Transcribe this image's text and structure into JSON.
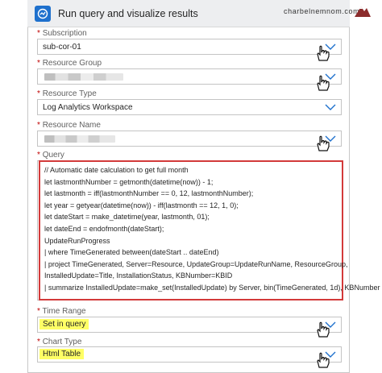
{
  "header": {
    "title": "Run query and visualize results",
    "icon": "azure-monitor-logs-icon",
    "accent": "#1e70cd"
  },
  "watermark": "charbelnemnom.com",
  "fields": {
    "subscription": {
      "label": "Subscription",
      "value": "sub-cor-01"
    },
    "resource_group": {
      "label": "Resource Group",
      "value": ""
    },
    "resource_type": {
      "label": "Resource Type",
      "value": "Log Analytics Workspace"
    },
    "resource_name": {
      "label": "Resource Name",
      "value": ""
    },
    "query": {
      "label": "Query",
      "lines": [
        "// Automatic date calculation to get full month",
        "let lastmonthNumber = getmonth(datetime(now)) - 1;",
        "let lastmonth = iff(lastmonthNumber == 0, 12, lastmonthNumber);",
        "let year = getyear(datetime(now)) - iff(lastmonth == 12, 1, 0);",
        "let dateStart = make_datetime(year, lastmonth, 01);",
        "let dateEnd = endofmonth(dateStart);",
        "UpdateRunProgress",
        "| where TimeGenerated between(dateStart .. dateEnd)",
        "| project TimeGenerated, Server=Resource, UpdateGroup=UpdateRunName, ResourceGroup,",
        "InstalledUpdate=Title, InstallationStatus, KBNumber=KBID",
        "| summarize InstalledUpdate=make_set(InstalledUpdate) by Server, bin(TimeGenerated, 1d), KBNumber"
      ]
    },
    "time_range": {
      "label": "Time Range",
      "value": "Set in query"
    },
    "chart_type": {
      "label": "Chart Type",
      "value": "Html Table"
    }
  },
  "required_mark": "*",
  "colors": {
    "highlight": "#ffff66",
    "query_outline": "#d33a3a",
    "required": "#c00000"
  }
}
